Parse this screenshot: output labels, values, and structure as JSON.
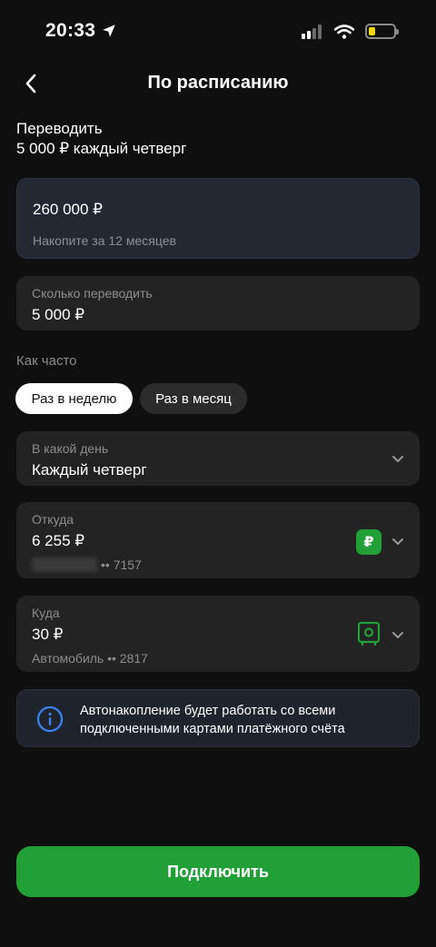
{
  "status_bar": {
    "time": "20:33"
  },
  "header": {
    "title": "По расписанию"
  },
  "summary": {
    "line1": "Переводить",
    "line2": "5 000 ₽ каждый четверг"
  },
  "goal": {
    "amount": "260 000 ₽",
    "subtitle": "Накопите за 12 месяцев"
  },
  "amount_field": {
    "label": "Сколько переводить",
    "value": "5 000 ₽"
  },
  "frequency": {
    "label": "Как часто",
    "options": [
      {
        "label": "Раз в неделю",
        "selected": true
      },
      {
        "label": "Раз в месяц",
        "selected": false
      }
    ]
  },
  "day_field": {
    "label": "В какой день",
    "value": "Каждый четверг"
  },
  "from_field": {
    "label": "Откуда",
    "value": "6 255 ₽",
    "account": "•• 7157",
    "badge": "₽"
  },
  "to_field": {
    "label": "Куда",
    "value": "30 ₽",
    "account": "Автомобиль •• 2817"
  },
  "info": {
    "text": "Автонакопление будет работать со всеми подключенными картами платёжного счёта"
  },
  "cta": {
    "label": "Подключить"
  },
  "colors": {
    "accent": "#21a038",
    "background": "#0f0f0f",
    "card": "#232323",
    "info_blue": "#3b82f6"
  }
}
